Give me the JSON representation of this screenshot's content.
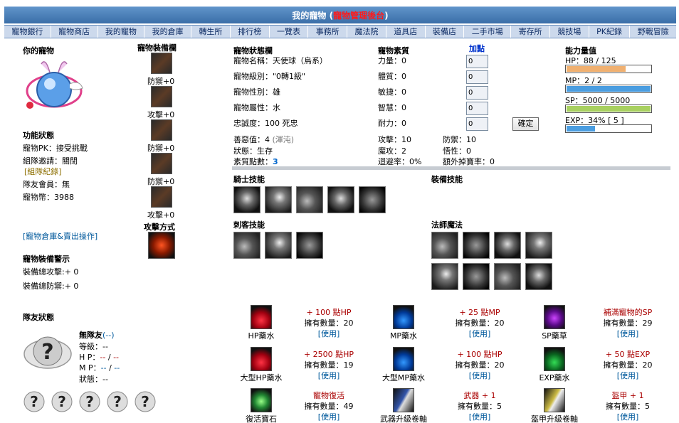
{
  "header": {
    "title_prefix": "我的寵物 (",
    "title_red": "寵物管理後台",
    "title_suffix": ")"
  },
  "nav": [
    "寵物銀行",
    "寵物商店",
    "我的寵物",
    "我的倉庫",
    "轉生所",
    "排行榜",
    "一覽表",
    "事務所",
    "魔法院",
    "道具店",
    "裝備店",
    "二手市場",
    "寄存所",
    "競技場",
    "PK紀錄",
    "野戰冒險"
  ],
  "pet_panel": {
    "title": "你的寵物",
    "function_status_title": "功能狀態",
    "pk": "寵物PK：接受挑戰",
    "team_invite": "組隊邀請：關閉",
    "team_record": "[組隊紀錄]",
    "team_member": "隊友會員：無",
    "pet_coins": "寵物幣：3988",
    "warehouse_link": "[寵物倉庫&賣出操作]",
    "equip_warning_title": "寵物裝備警示",
    "equip_total_atk": "裝備總攻擊:+ 0",
    "equip_total_def": "裝備總防禦:+ 0"
  },
  "equip_column": {
    "title": "寵物裝備欄",
    "slots": [
      "防禦+0",
      "攻擊+0",
      "防禦+0",
      "防禦+0",
      "攻擊+0"
    ],
    "attack_mode": "攻擊方式"
  },
  "status": {
    "title": "寵物狀態欄",
    "name": "寵物名稱：天使球（烏系）",
    "level": "寵物級別：\"0轉1級\"",
    "gender": "寵物性別：雄",
    "attribute": "寵物屬性：水",
    "loyalty": "忠誠度：100 死忠",
    "alignment_label": "善惡值：4",
    "alignment_note": "(渾沌)",
    "state": "狀態：生存",
    "points_label": "素質點數：",
    "points_value": "3"
  },
  "quality": {
    "title": "寵物素質",
    "add_label": "加點",
    "rows": [
      "力量：0",
      "體質：0",
      "敏捷：0",
      "智慧：0",
      "耐力：0"
    ],
    "input_values": [
      "0",
      "0",
      "0",
      "0",
      "0"
    ],
    "confirm": "確定"
  },
  "combat": {
    "attack": "攻擊：10",
    "defense": "防禦：10",
    "magic_attack": "魔攻：2",
    "intellect": "悟性：0",
    "evasion": "迴避率：0%",
    "extra_drop": "額外掉寶率：0"
  },
  "ability": {
    "title": "能力量值",
    "hp": "HP：88 / 125",
    "mp": "MP：2 / 2",
    "sp": "SP：5000 / 5000",
    "exp": "EXP：34% [ 5 ]",
    "hp_ratio": 0.704,
    "mp_ratio": 1.0,
    "sp_ratio": 1.0,
    "exp_ratio": 0.34,
    "colors": {
      "hp": "#f0b070",
      "mp": "#4a9de0",
      "sp": "#a8d060",
      "exp": "#4a9de0"
    }
  },
  "skills": {
    "knight": "騎士技能",
    "equip": "裝備技能",
    "assassin": "刺客技能",
    "mage": "法師魔法"
  },
  "team": {
    "title": "隊友狀態",
    "no_member": "無隊友",
    "no_member_sub": "(--)",
    "level": "等級：--",
    "hp_label": "H P：",
    "hp_a": "--",
    "hp_b": "--",
    "mp_label": "M P：",
    "mp_a": "--",
    "mp_b": "--",
    "state": "狀態：--"
  },
  "items": [
    {
      "name": "HP藥水",
      "effect": "+ 100 點HP",
      "count": "擁有數量：20",
      "use": "[使用]",
      "icon": "potion-red"
    },
    {
      "name": "MP藥水",
      "effect": "+ 25 點MP",
      "count": "擁有數量：20",
      "use": "[使用]",
      "icon": "potion-blue"
    },
    {
      "name": "SP藥草",
      "effect": "補滿寵物的SP",
      "count": "擁有數量：29",
      "use": "[使用]",
      "icon": "herb-purple"
    },
    {
      "name": "大型HP藥水",
      "effect": "+ 2500 點HP",
      "count": "擁有數量：19",
      "use": "[使用]",
      "icon": "potion-red"
    },
    {
      "name": "大型MP藥水",
      "effect": "+ 100 點HP",
      "count": "擁有數量：20",
      "use": "[使用]",
      "icon": "potion-blue"
    },
    {
      "name": "EXP藥水",
      "effect": "+ 50 點EXP",
      "count": "擁有數量：20",
      "use": "[使用]",
      "icon": "potion-green"
    },
    {
      "name": "復活寶石",
      "effect": "寵物復活",
      "count": "擁有數量：49",
      "use": "[使用]",
      "icon": "revive-stone"
    },
    {
      "name": "武器升級卷軸",
      "effect": "武器 + 1",
      "count": "擁有數量：5",
      "use": "[使用]",
      "icon": "weapon-scroll"
    },
    {
      "name": "盔甲升級卷軸",
      "effect": "盔甲 + 1",
      "count": "擁有數量：5",
      "use": "[使用]",
      "icon": "armor-scroll"
    }
  ]
}
